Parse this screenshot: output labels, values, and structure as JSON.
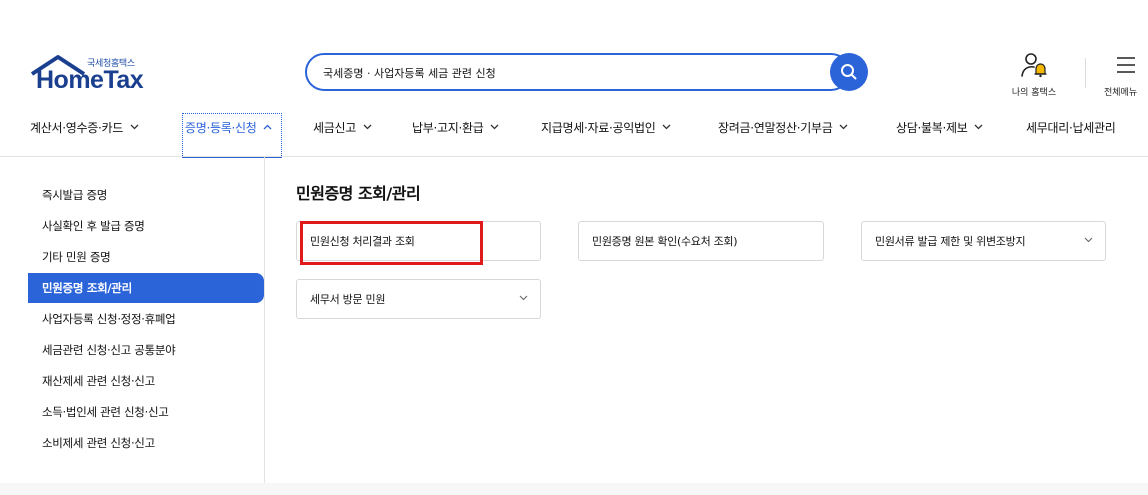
{
  "header": {
    "logo_sub": "국세청홈택스",
    "logo_brand": "HomeTax",
    "search": {
      "value": "국세증명 · 사업자등록 세금 관련 신청",
      "placeholder": ""
    },
    "utils": [
      {
        "label": "나의 홈택스",
        "icon": "user-bell-icon"
      },
      {
        "label": "전체메뉴",
        "icon": "hamburger-menu-icon"
      }
    ]
  },
  "gnb": {
    "items": [
      {
        "label": "계산서·영수증·카드",
        "active": false
      },
      {
        "label": "증명·등록·신청",
        "active": true
      },
      {
        "label": "세금신고",
        "active": false
      },
      {
        "label": "납부·고지·환급",
        "active": false
      },
      {
        "label": "지급명세·자료·공익법인",
        "active": false
      },
      {
        "label": "장려금·연말정산·기부금",
        "active": false
      },
      {
        "label": "상담·불복·제보",
        "active": false
      },
      {
        "label": "세무대리·납세관리",
        "active": false
      }
    ]
  },
  "lnb": {
    "items": [
      {
        "label": "즉시발급 증명",
        "active": false
      },
      {
        "label": "사실확인 후 발급 증명",
        "active": false
      },
      {
        "label": "기타 민원 증명",
        "active": false
      },
      {
        "label": "민원증명 조회/관리",
        "active": true
      },
      {
        "label": "사업자등록 신청·정정·휴폐업",
        "active": false
      },
      {
        "label": "세금관련 신청·신고 공통분야",
        "active": false
      },
      {
        "label": "재산제세 관련 신청·신고",
        "active": false
      },
      {
        "label": "소득·법인세 관련 신청·신고",
        "active": false
      },
      {
        "label": "소비제세 관련 신청·신고",
        "active": false
      }
    ]
  },
  "content": {
    "title": "민원증명 조회/관리",
    "cards": [
      {
        "label": "민원신청 처리결과 조회",
        "has_dropdown": false,
        "highlighted": true
      },
      {
        "label": "민원증명 원본 확인(수요처 조회)",
        "has_dropdown": false,
        "highlighted": false
      },
      {
        "label": "민원서류 발급 제한 및 위변조방지",
        "has_dropdown": true,
        "highlighted": false
      },
      {
        "label": "세무서 방문 민원",
        "has_dropdown": true,
        "highlighted": false
      }
    ]
  },
  "colors": {
    "accent": "#2b63d9",
    "brand": "#1b3f8f",
    "highlight": "#e0191b",
    "bell": "#f5b800"
  }
}
